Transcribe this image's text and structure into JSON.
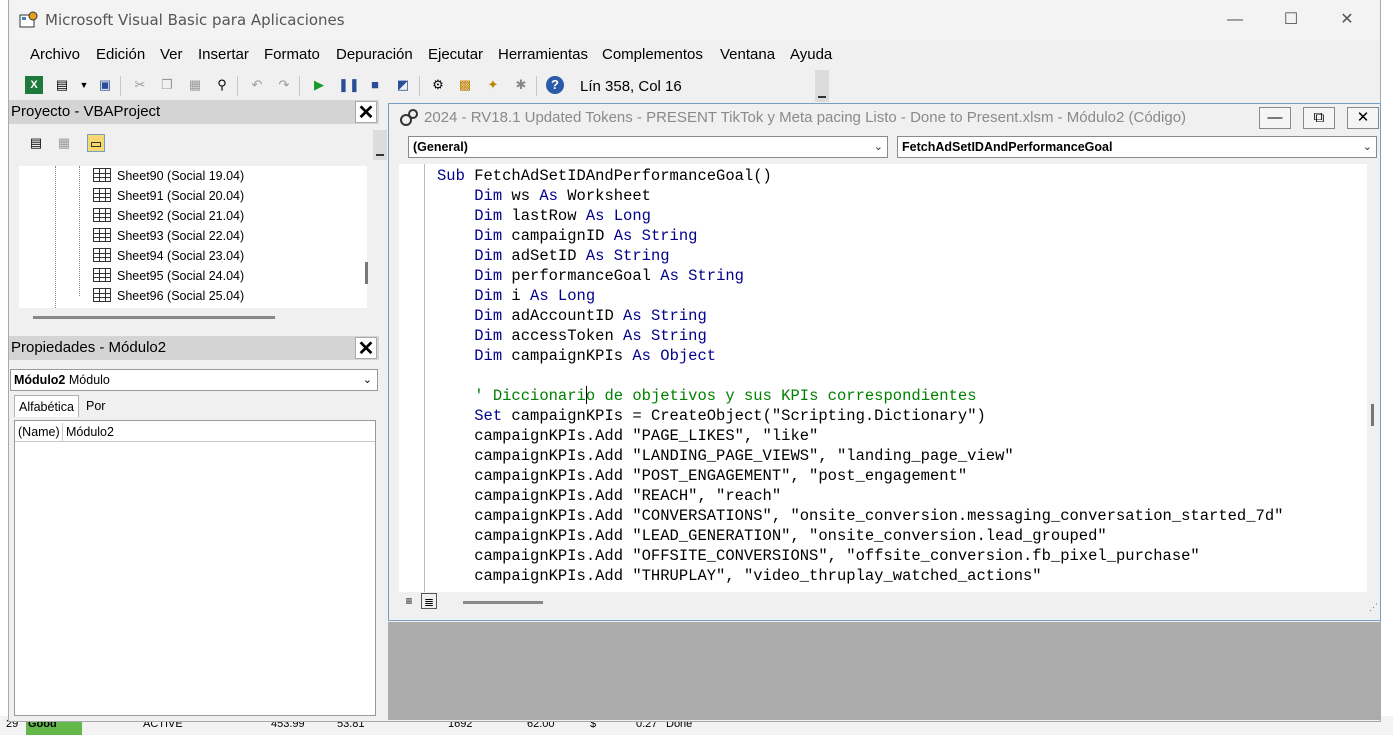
{
  "window": {
    "title": "Microsoft Visual Basic para Aplicaciones"
  },
  "menu": [
    "Archivo",
    "Edición",
    "Ver",
    "Insertar",
    "Formato",
    "Depuración",
    "Ejecutar",
    "Herramientas",
    "Complementos",
    "Ventana",
    "Ayuda"
  ],
  "toolbar": {
    "status": "Lín 358, Col 16"
  },
  "project": {
    "title": "Proyecto - VBAProject",
    "items": [
      "Sheet90 (Social 19.04)",
      "Sheet91 (Social 20.04)",
      "Sheet92 (Social 21.04)",
      "Sheet93 (Social 22.04)",
      "Sheet94 (Social 23.04)",
      "Sheet95 (Social 24.04)",
      "Sheet96 (Social 25.04)"
    ]
  },
  "properties": {
    "title": "Propiedades - Módulo2",
    "combo_name": "Módulo2",
    "combo_type": "Módulo",
    "tab_alpha": "Alfabética",
    "tab_cat": "Por categorías",
    "row_name": "(Name)",
    "row_value": "Módulo2"
  },
  "code": {
    "title": "2024 - RV18.1 Updated Tokens - PRESENT TikTok y Meta pacing Listo - Done to Present.xlsm - Módulo2 (Código)",
    "object_combo": "(General)",
    "proc_combo": "FetchAdSetIDAndPerformanceGoal",
    "lines": [
      [
        {
          "t": "kw",
          "s": "Sub"
        },
        {
          "t": "n",
          "s": " FetchAdSetIDAndPerformanceGoal()"
        }
      ],
      [
        {
          "t": "n",
          "s": "    "
        },
        {
          "t": "kw",
          "s": "Dim"
        },
        {
          "t": "n",
          "s": " ws "
        },
        {
          "t": "kw",
          "s": "As"
        },
        {
          "t": "n",
          "s": " Worksheet"
        }
      ],
      [
        {
          "t": "n",
          "s": "    "
        },
        {
          "t": "kw",
          "s": "Dim"
        },
        {
          "t": "n",
          "s": " lastRow "
        },
        {
          "t": "kw",
          "s": "As Long"
        }
      ],
      [
        {
          "t": "n",
          "s": "    "
        },
        {
          "t": "kw",
          "s": "Dim"
        },
        {
          "t": "n",
          "s": " campaignID "
        },
        {
          "t": "kw",
          "s": "As String"
        }
      ],
      [
        {
          "t": "n",
          "s": "    "
        },
        {
          "t": "kw",
          "s": "Dim"
        },
        {
          "t": "n",
          "s": " adSetID "
        },
        {
          "t": "kw",
          "s": "As String"
        }
      ],
      [
        {
          "t": "n",
          "s": "    "
        },
        {
          "t": "kw",
          "s": "Dim"
        },
        {
          "t": "n",
          "s": " performanceGoal "
        },
        {
          "t": "kw",
          "s": "As String"
        }
      ],
      [
        {
          "t": "n",
          "s": "    "
        },
        {
          "t": "kw",
          "s": "Dim"
        },
        {
          "t": "n",
          "s": " i "
        },
        {
          "t": "kw",
          "s": "As Long"
        }
      ],
      [
        {
          "t": "n",
          "s": "    "
        },
        {
          "t": "kw",
          "s": "Dim"
        },
        {
          "t": "n",
          "s": " adAccountID "
        },
        {
          "t": "kw",
          "s": "As String"
        }
      ],
      [
        {
          "t": "n",
          "s": "    "
        },
        {
          "t": "kw",
          "s": "Dim"
        },
        {
          "t": "n",
          "s": " accessToken "
        },
        {
          "t": "kw",
          "s": "As String"
        }
      ],
      [
        {
          "t": "n",
          "s": "    "
        },
        {
          "t": "kw",
          "s": "Dim"
        },
        {
          "t": "n",
          "s": " campaignKPIs "
        },
        {
          "t": "kw",
          "s": "As Object"
        }
      ],
      [],
      [
        {
          "t": "n",
          "s": "    "
        },
        {
          "t": "cm",
          "s": "' Diccionario de objetivos y sus KPIs correspondientes"
        }
      ],
      [
        {
          "t": "n",
          "s": "    "
        },
        {
          "t": "kw",
          "s": "Set"
        },
        {
          "t": "n",
          "s": " campaignKPIs = CreateObject(\"Scripting.Dictionary\")"
        }
      ],
      [
        {
          "t": "n",
          "s": "    campaignKPIs.Add \"PAGE_LIKES\", \"like\""
        }
      ],
      [
        {
          "t": "n",
          "s": "    campaignKPIs.Add \"LANDING_PAGE_VIEWS\", \"landing_page_view\""
        }
      ],
      [
        {
          "t": "n",
          "s": "    campaignKPIs.Add \"POST_ENGAGEMENT\", \"post_engagement\""
        }
      ],
      [
        {
          "t": "n",
          "s": "    campaignKPIs.Add \"REACH\", \"reach\""
        }
      ],
      [
        {
          "t": "n",
          "s": "    campaignKPIs.Add \"CONVERSATIONS\", \"onsite_conversion.messaging_conversation_started_7d\""
        }
      ],
      [
        {
          "t": "n",
          "s": "    campaignKPIs.Add \"LEAD_GENERATION\", \"onsite_conversion.lead_grouped\""
        }
      ],
      [
        {
          "t": "n",
          "s": "    campaignKPIs.Add \"OFFSITE_CONVERSIONS\", \"offsite_conversion.fb_pixel_purchase\""
        }
      ],
      [
        {
          "t": "n",
          "s": "    campaignKPIs.Add \"THRUPLAY\", \"video_thruplay_watched_actions\""
        }
      ]
    ]
  },
  "excel_row": {
    "row_num": "29",
    "status": "Good",
    "state": "ACTIVE",
    "v1": "453.99",
    "v2": "53.81",
    "v3": "1692",
    "v4": "62.00",
    "currency": "$",
    "v5": "0.27",
    "result": "Done"
  }
}
